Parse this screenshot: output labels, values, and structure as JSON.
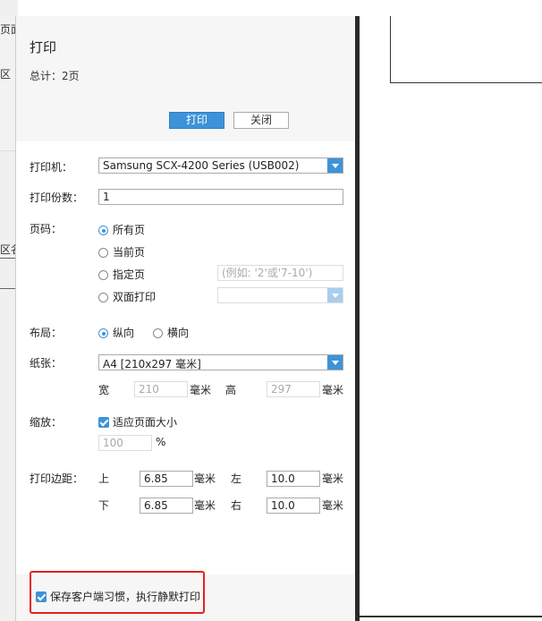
{
  "background": {
    "tab_fragment": "页面",
    "area_fragment": "区",
    "area_name_fragment": "区名"
  },
  "dialog": {
    "title": "打印",
    "total": "总计：2页",
    "print_button": "打印",
    "close_button": "关闭"
  },
  "form": {
    "printer_label": "打印机：",
    "printer_value": "Samsung SCX-4200 Series (USB002)",
    "copies_label": "打印份数：",
    "copies_value": "1",
    "pages_label": "页码：",
    "pages_options": [
      "所有页",
      "当前页",
      "指定页",
      "双面打印"
    ],
    "pages_selected": 0,
    "page_range_placeholder": "(例如: '2'或'7-10')",
    "layout_label": "布局：",
    "layout_options": [
      "纵向",
      "横向"
    ],
    "layout_selected": 0,
    "paper_label": "纸张：",
    "paper_value": "A4 [210x297 毫米]",
    "width_label": "宽",
    "width_value": "210",
    "height_label": "高",
    "height_value": "297",
    "unit_mm": "毫米",
    "scale_label": "缩放：",
    "fit_page_label": "适应页面大小",
    "fit_page_checked": true,
    "scale_value": "100",
    "percent": "%",
    "margin_label": "打印边距：",
    "margin_top_label": "上",
    "margin_top_value": "6.85",
    "margin_left_label": "左",
    "margin_left_value": "10.0",
    "margin_bottom_label": "下",
    "margin_bottom_value": "6.85",
    "margin_right_label": "右",
    "margin_right_value": "10.0"
  },
  "footer": {
    "save_habit_label": "保存客户端习惯，执行静默打印",
    "save_habit_checked": true
  },
  "colors": {
    "accent": "#3e93d8",
    "highlight": "#e62020"
  }
}
